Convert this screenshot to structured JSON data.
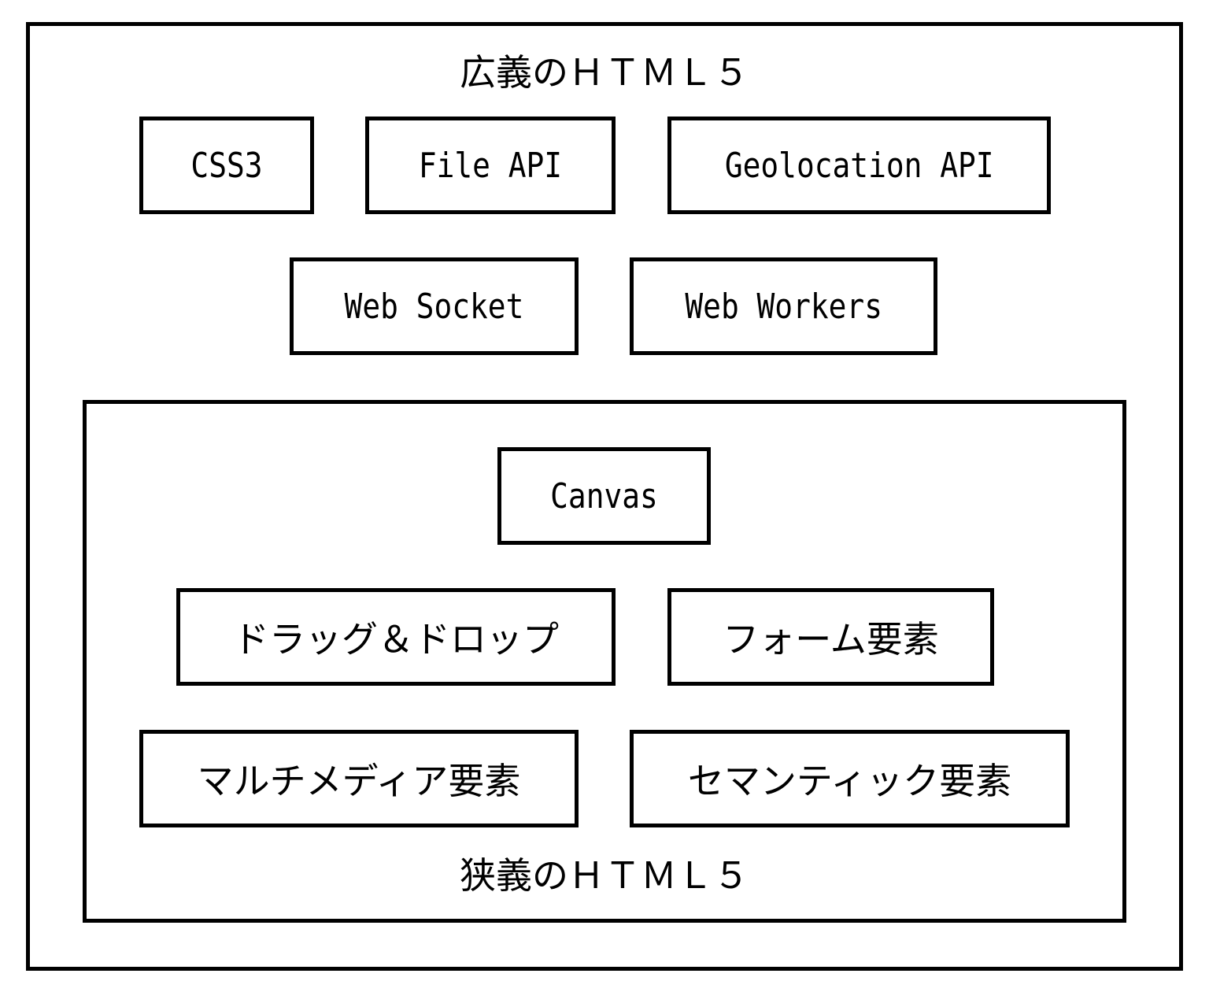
{
  "outer": {
    "title": "広義のＨＴＭＬ５",
    "items": [
      "CSS3",
      "File API",
      "Geolocation API",
      "Web Socket",
      "Web Workers"
    ]
  },
  "inner": {
    "title": "狭義のＨＴＭＬ５",
    "items": [
      "Canvas",
      "ドラッグ＆ドロップ",
      "フォーム要素",
      "マルチメディア要素",
      "セマンティック要素"
    ]
  }
}
